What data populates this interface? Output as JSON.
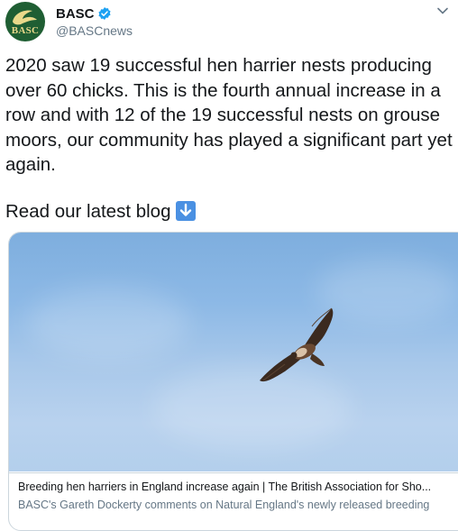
{
  "author": {
    "display_name": "BASC",
    "handle": "@BASCnews",
    "avatar_text": "BASC",
    "verified_icon": "verified-badge-icon",
    "avatar_color": "#1f5e33"
  },
  "tweet": {
    "text": "2020 saw 19 successful hen harrier nests producing over 60 chicks. This is the fourth annual increase in a row and with 12 of the 19 successful nests on grouse moors, our community has played a significant part yet again.",
    "cta_text": "Read our latest blog",
    "cta_icon": "down-arrow-emoji-icon"
  },
  "link_card": {
    "title": "Breeding hen harriers in England increase again | The British Association for Sho...",
    "description": "BASC's Gareth Dockerty comments on Natural England's newly released breeding",
    "image_subject": "hen-harrier-in-flight-image"
  },
  "menu_icon": "chevron-down-icon",
  "colors": {
    "accent": "#1da1f2",
    "muted": "#657786",
    "border": "#ccd6dd"
  }
}
